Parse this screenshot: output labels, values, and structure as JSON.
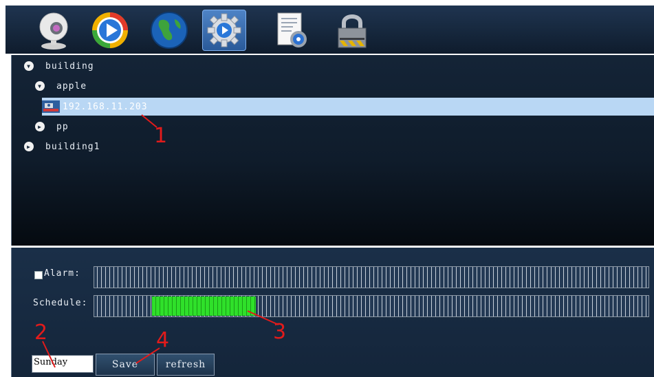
{
  "toolbar": {
    "icons": [
      {
        "name": "webcam-icon"
      },
      {
        "name": "play-icon"
      },
      {
        "name": "globe-icon"
      },
      {
        "name": "gear-icon",
        "active": true
      },
      {
        "name": "settings-document-icon"
      },
      {
        "name": "lock-icon"
      }
    ]
  },
  "tree": {
    "nodes": [
      {
        "label": "building",
        "expanded": true
      },
      {
        "label": "apple",
        "expanded": true
      },
      {
        "label": "192.168.11.203",
        "selected": true
      },
      {
        "label": "pp",
        "expanded": false
      },
      {
        "label": "building1",
        "expanded": false
      }
    ]
  },
  "schedule_panel": {
    "alarm_label": "Alarm:",
    "alarm_checked": false,
    "schedule_label": "Schedule:",
    "schedule_active_segments": {
      "start": 14,
      "end": 39,
      "total": 134
    },
    "day_value": "Sunday",
    "save_label": "Save",
    "refresh_label": "refresh"
  },
  "annotations": [
    "1",
    "2",
    "3",
    "4"
  ],
  "colors": {
    "accent_selected": "#b9d7f4",
    "schedule_green": "#2fe02a",
    "annotation_red": "#e21b1b"
  }
}
